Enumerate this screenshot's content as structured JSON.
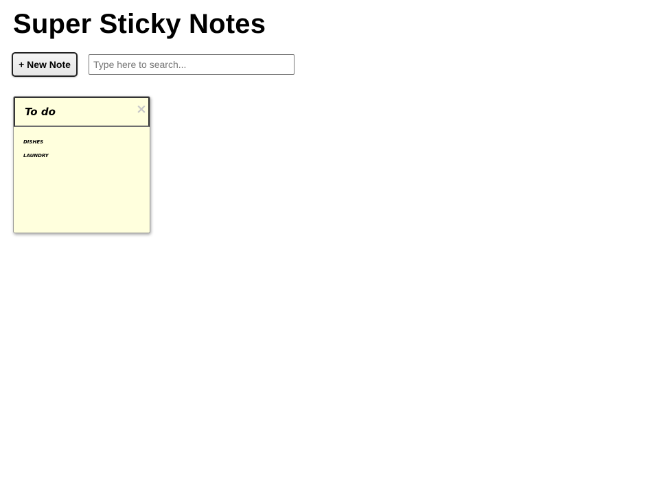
{
  "header": {
    "title": "Super Sticky Notes"
  },
  "toolbar": {
    "new_note_label": "+ New Note",
    "search": {
      "value": "",
      "placeholder": "Type here to search..."
    }
  },
  "notes": [
    {
      "title": "To do",
      "close_glyph": "×",
      "body_lines": [
        "dishes",
        "laundry"
      ]
    }
  ],
  "colors": {
    "note_background": "#ffffdd",
    "close_icon": "#c8c8c8"
  }
}
